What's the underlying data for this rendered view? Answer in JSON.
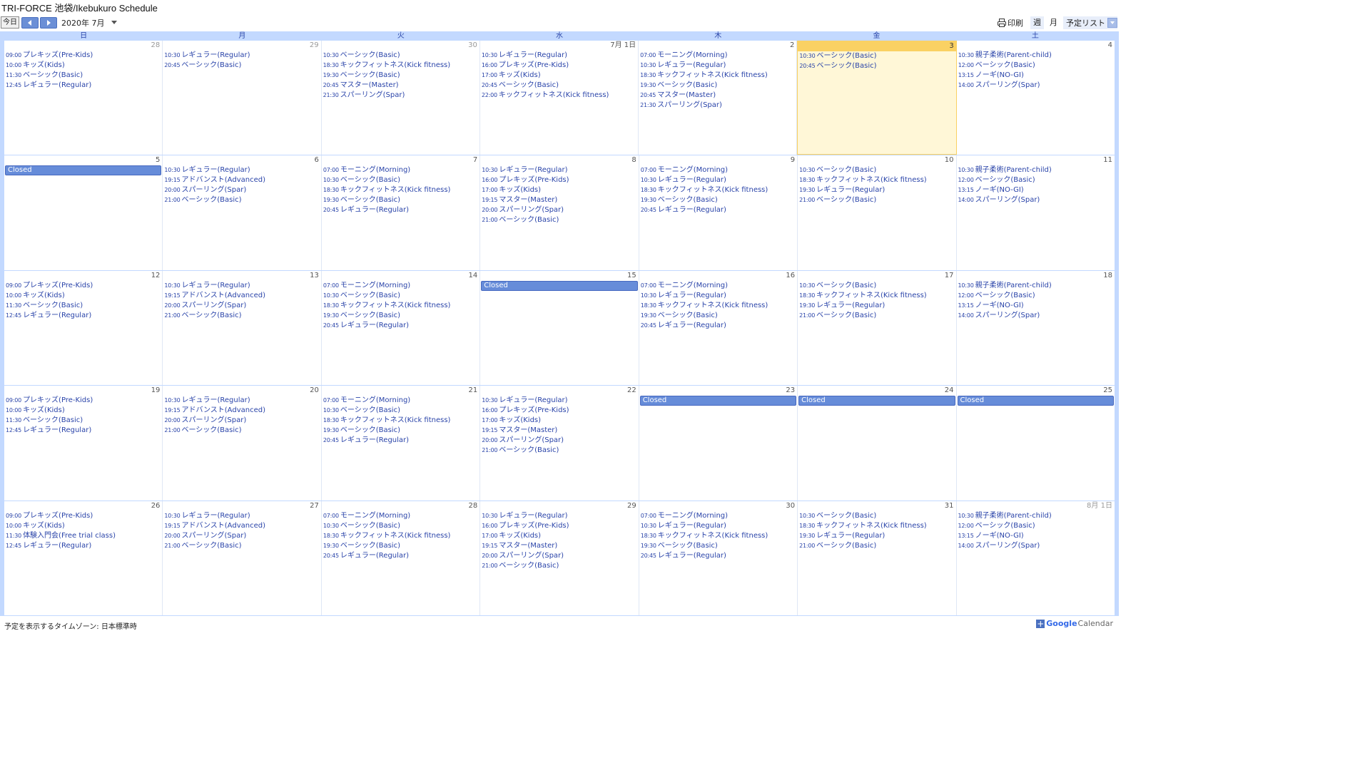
{
  "header": {
    "title": "TRI-FORCE 池袋/Ikebukuro Schedule",
    "today_label": "今日",
    "month_label": "2020年 7月",
    "print_label": "印刷",
    "week_label": "週",
    "month_view_label": "月",
    "agenda_label": "予定リスト"
  },
  "dow": [
    "日",
    "月",
    "火",
    "水",
    "木",
    "金",
    "土"
  ],
  "weeks": [
    [
      {
        "num": "28",
        "other": true,
        "events": [
          [
            "09:00",
            "プレキッズ(Pre-Kids)"
          ],
          [
            "10:00",
            "キッズ(Kids)"
          ],
          [
            "11:30",
            "ベーシック(Basic)"
          ],
          [
            "12:45",
            "レギュラー(Regular)"
          ]
        ]
      },
      {
        "num": "29",
        "other": true,
        "events": [
          [
            "10:30",
            "レギュラー(Regular)"
          ],
          [
            "20:45",
            "ベーシック(Basic)"
          ]
        ]
      },
      {
        "num": "30",
        "other": true,
        "events": [
          [
            "10:30",
            "ベーシック(Basic)"
          ],
          [
            "18:30",
            "キックフィットネス(Kick fitness)"
          ],
          [
            "19:30",
            "ベーシック(Basic)"
          ],
          [
            "20:45",
            "マスター(Master)"
          ],
          [
            "21:30",
            "スパーリング(Spar)"
          ]
        ]
      },
      {
        "num": "7月 1日",
        "events": [
          [
            "10:30",
            "レギュラー(Regular)"
          ],
          [
            "16:00",
            "プレキッズ(Pre-Kids)"
          ],
          [
            "17:00",
            "キッズ(Kids)"
          ],
          [
            "20:45",
            "ベーシック(Basic)"
          ],
          [
            "22:00",
            "キックフィットネス(Kick fitness)"
          ]
        ]
      },
      {
        "num": "2",
        "events": [
          [
            "07:00",
            "モーニング(Morning)"
          ],
          [
            "10:30",
            "レギュラー(Regular)"
          ],
          [
            "18:30",
            "キックフィットネス(Kick fitness)"
          ],
          [
            "19:30",
            "ベーシック(Basic)"
          ],
          [
            "20:45",
            "マスター(Master)"
          ],
          [
            "21:30",
            "スパーリング(Spar)"
          ]
        ]
      },
      {
        "num": "3",
        "today": true,
        "events": [
          [
            "10:30",
            "ベーシック(Basic)"
          ],
          [
            "20:45",
            "ベーシック(Basic)"
          ]
        ]
      },
      {
        "num": "4",
        "events": [
          [
            "10:30",
            "親子柔術(Parent-child)"
          ],
          [
            "12:00",
            "ベーシック(Basic)"
          ],
          [
            "13:15",
            "ノーギ(NO-GI)"
          ],
          [
            "14:00",
            "スパーリング(Spar)"
          ]
        ]
      }
    ],
    [
      {
        "num": "5",
        "closed": "Closed",
        "events": []
      },
      {
        "num": "6",
        "events": [
          [
            "10:30",
            "レギュラー(Regular)"
          ],
          [
            "19:15",
            "アドバンスト(Advanced)"
          ],
          [
            "20:00",
            "スパーリング(Spar)"
          ],
          [
            "21:00",
            "ベーシック(Basic)"
          ]
        ]
      },
      {
        "num": "7",
        "events": [
          [
            "07:00",
            "モーニング(Morning)"
          ],
          [
            "10:30",
            "ベーシック(Basic)"
          ],
          [
            "18:30",
            "キックフィットネス(Kick fitness)"
          ],
          [
            "19:30",
            "ベーシック(Basic)"
          ],
          [
            "20:45",
            "レギュラー(Regular)"
          ]
        ]
      },
      {
        "num": "8",
        "events": [
          [
            "10:30",
            "レギュラー(Regular)"
          ],
          [
            "16:00",
            "プレキッズ(Pre-Kids)"
          ],
          [
            "17:00",
            "キッズ(Kids)"
          ],
          [
            "19:15",
            "マスター(Master)"
          ],
          [
            "20:00",
            "スパーリング(Spar)"
          ],
          [
            "21:00",
            "ベーシック(Basic)"
          ]
        ]
      },
      {
        "num": "9",
        "events": [
          [
            "07:00",
            "モーニング(Morning)"
          ],
          [
            "10:30",
            "レギュラー(Regular)"
          ],
          [
            "18:30",
            "キックフィットネス(Kick fitness)"
          ],
          [
            "19:30",
            "ベーシック(Basic)"
          ],
          [
            "20:45",
            "レギュラー(Regular)"
          ]
        ]
      },
      {
        "num": "10",
        "events": [
          [
            "10:30",
            "ベーシック(Basic)"
          ],
          [
            "18:30",
            "キックフィットネス(Kick fitness)"
          ],
          [
            "19:30",
            "レギュラー(Regular)"
          ],
          [
            "21:00",
            "ベーシック(Basic)"
          ]
        ]
      },
      {
        "num": "11",
        "events": [
          [
            "10:30",
            "親子柔術(Parent-child)"
          ],
          [
            "12:00",
            "ベーシック(Basic)"
          ],
          [
            "13:15",
            "ノーギ(NO-GI)"
          ],
          [
            "14:00",
            "スパーリング(Spar)"
          ]
        ]
      }
    ],
    [
      {
        "num": "12",
        "events": [
          [
            "09:00",
            "プレキッズ(Pre-Kids)"
          ],
          [
            "10:00",
            "キッズ(Kids)"
          ],
          [
            "11:30",
            "ベーシック(Basic)"
          ],
          [
            "12:45",
            "レギュラー(Regular)"
          ]
        ]
      },
      {
        "num": "13",
        "events": [
          [
            "10:30",
            "レギュラー(Regular)"
          ],
          [
            "19:15",
            "アドバンスト(Advanced)"
          ],
          [
            "20:00",
            "スパーリング(Spar)"
          ],
          [
            "21:00",
            "ベーシック(Basic)"
          ]
        ]
      },
      {
        "num": "14",
        "events": [
          [
            "07:00",
            "モーニング(Morning)"
          ],
          [
            "10:30",
            "ベーシック(Basic)"
          ],
          [
            "18:30",
            "キックフィットネス(Kick fitness)"
          ],
          [
            "19:30",
            "ベーシック(Basic)"
          ],
          [
            "20:45",
            "レギュラー(Regular)"
          ]
        ]
      },
      {
        "num": "15",
        "closed": "Closed",
        "events": []
      },
      {
        "num": "16",
        "events": [
          [
            "07:00",
            "モーニング(Morning)"
          ],
          [
            "10:30",
            "レギュラー(Regular)"
          ],
          [
            "18:30",
            "キックフィットネス(Kick fitness)"
          ],
          [
            "19:30",
            "ベーシック(Basic)"
          ],
          [
            "20:45",
            "レギュラー(Regular)"
          ]
        ]
      },
      {
        "num": "17",
        "events": [
          [
            "10:30",
            "ベーシック(Basic)"
          ],
          [
            "18:30",
            "キックフィットネス(Kick fitness)"
          ],
          [
            "19:30",
            "レギュラー(Regular)"
          ],
          [
            "21:00",
            "ベーシック(Basic)"
          ]
        ]
      },
      {
        "num": "18",
        "events": [
          [
            "10:30",
            "親子柔術(Parent-child)"
          ],
          [
            "12:00",
            "ベーシック(Basic)"
          ],
          [
            "13:15",
            "ノーギ(NO-GI)"
          ],
          [
            "14:00",
            "スパーリング(Spar)"
          ]
        ]
      }
    ],
    [
      {
        "num": "19",
        "events": [
          [
            "09:00",
            "プレキッズ(Pre-Kids)"
          ],
          [
            "10:00",
            "キッズ(Kids)"
          ],
          [
            "11:30",
            "ベーシック(Basic)"
          ],
          [
            "12:45",
            "レギュラー(Regular)"
          ]
        ]
      },
      {
        "num": "20",
        "events": [
          [
            "10:30",
            "レギュラー(Regular)"
          ],
          [
            "19:15",
            "アドバンスト(Advanced)"
          ],
          [
            "20:00",
            "スパーリング(Spar)"
          ],
          [
            "21:00",
            "ベーシック(Basic)"
          ]
        ]
      },
      {
        "num": "21",
        "events": [
          [
            "07:00",
            "モーニング(Morning)"
          ],
          [
            "10:30",
            "ベーシック(Basic)"
          ],
          [
            "18:30",
            "キックフィットネス(Kick fitness)"
          ],
          [
            "19:30",
            "ベーシック(Basic)"
          ],
          [
            "20:45",
            "レギュラー(Regular)"
          ]
        ]
      },
      {
        "num": "22",
        "events": [
          [
            "10:30",
            "レギュラー(Regular)"
          ],
          [
            "16:00",
            "プレキッズ(Pre-Kids)"
          ],
          [
            "17:00",
            "キッズ(Kids)"
          ],
          [
            "19:15",
            "マスター(Master)"
          ],
          [
            "20:00",
            "スパーリング(Spar)"
          ],
          [
            "21:00",
            "ベーシック(Basic)"
          ]
        ]
      },
      {
        "num": "23",
        "closed": "Closed",
        "events": []
      },
      {
        "num": "24",
        "closed": "Closed",
        "events": []
      },
      {
        "num": "25",
        "closed": "Closed",
        "events": []
      }
    ],
    [
      {
        "num": "26",
        "events": [
          [
            "09:00",
            "プレキッズ(Pre-Kids)"
          ],
          [
            "10:00",
            "キッズ(Kids)"
          ],
          [
            "11:30",
            "体験入門会(Free trial class)"
          ],
          [
            "12:45",
            "レギュラー(Regular)"
          ]
        ]
      },
      {
        "num": "27",
        "events": [
          [
            "10:30",
            "レギュラー(Regular)"
          ],
          [
            "19:15",
            "アドバンスト(Advanced)"
          ],
          [
            "20:00",
            "スパーリング(Spar)"
          ],
          [
            "21:00",
            "ベーシック(Basic)"
          ]
        ]
      },
      {
        "num": "28",
        "events": [
          [
            "07:00",
            "モーニング(Morning)"
          ],
          [
            "10:30",
            "ベーシック(Basic)"
          ],
          [
            "18:30",
            "キックフィットネス(Kick fitness)"
          ],
          [
            "19:30",
            "ベーシック(Basic)"
          ],
          [
            "20:45",
            "レギュラー(Regular)"
          ]
        ]
      },
      {
        "num": "29",
        "events": [
          [
            "10:30",
            "レギュラー(Regular)"
          ],
          [
            "16:00",
            "プレキッズ(Pre-Kids)"
          ],
          [
            "17:00",
            "キッズ(Kids)"
          ],
          [
            "19:15",
            "マスター(Master)"
          ],
          [
            "20:00",
            "スパーリング(Spar)"
          ],
          [
            "21:00",
            "ベーシック(Basic)"
          ]
        ]
      },
      {
        "num": "30",
        "events": [
          [
            "07:00",
            "モーニング(Morning)"
          ],
          [
            "10:30",
            "レギュラー(Regular)"
          ],
          [
            "18:30",
            "キックフィットネス(Kick fitness)"
          ],
          [
            "19:30",
            "ベーシック(Basic)"
          ],
          [
            "20:45",
            "レギュラー(Regular)"
          ]
        ]
      },
      {
        "num": "31",
        "events": [
          [
            "10:30",
            "ベーシック(Basic)"
          ],
          [
            "18:30",
            "キックフィットネス(Kick fitness)"
          ],
          [
            "19:30",
            "レギュラー(Regular)"
          ],
          [
            "21:00",
            "ベーシック(Basic)"
          ]
        ]
      },
      {
        "num": "8月 1日",
        "other": true,
        "events": [
          [
            "10:30",
            "親子柔術(Parent-child)"
          ],
          [
            "12:00",
            "ベーシック(Basic)"
          ],
          [
            "13:15",
            "ノーギ(NO-GI)"
          ],
          [
            "14:00",
            "スパーリング(Spar)"
          ]
        ]
      }
    ]
  ],
  "footer": {
    "timezone": "予定を表示するタイムゾーン: 日本標準時",
    "google": "Google",
    "calendar": "Calendar",
    "plus": "+"
  },
  "colors": {
    "accent": "#668cd9",
    "today_bg": "#fff7d7",
    "today_header": "#fad163",
    "event_text": "#2a44a9",
    "border": "#c3d9ff"
  }
}
